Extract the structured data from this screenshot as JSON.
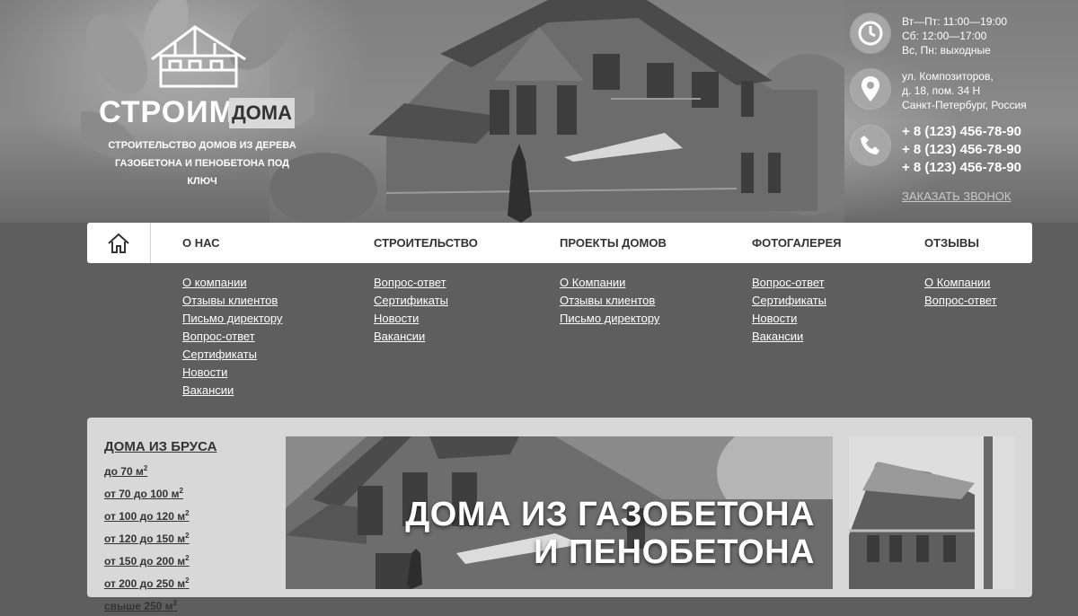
{
  "logo": {
    "word": "СТРОИМ",
    "box": "ДОМА",
    "subtitle_line1": "СТРОИТЕЛЬСТВО ДОМОВ ИЗ ДЕРЕВА",
    "subtitle_line2": "ГАЗОБЕТОНА И ПЕНОБЕТОНА ПОД КЛЮЧ"
  },
  "hours": {
    "line1": "Вт—Пт: 11:00—19:00",
    "line2": "Сб: 12:00—17:00",
    "line3": "Вс, Пн: выходные",
    "icon": "clock-icon"
  },
  "address": {
    "line1": "ул. Композиторов,",
    "line2": "д. 18, пом. 34 Н",
    "line3": "Санкт-Петербург, Россия",
    "icon": "location-pin-icon"
  },
  "phones": {
    "icon": "phone-icon",
    "items": [
      "+ 8 (123) 456-78-90",
      "+ 8 (123) 456-78-90",
      "+ 8 (123) 456-78-90"
    ]
  },
  "callback_label": "ЗАКАЗАТЬ ЗВОНОК",
  "nav": {
    "home_icon": "home-icon",
    "items": [
      {
        "label": "О НАС",
        "sub": [
          "О компании",
          "Отзывы клиентов",
          "Письмо директору",
          "Вопрос-ответ",
          "Сертификаты",
          "Новости",
          "Вакансии"
        ]
      },
      {
        "label": "СТРОИТЕЛЬСТВО",
        "sub": [
          "Вопрос-ответ",
          "Сертификаты",
          "Новости",
          "Вакансии"
        ]
      },
      {
        "label": "ПРОЕКТЫ ДОМОВ",
        "sub": [
          "О Компании",
          "Отзывы клиентов",
          "Письмо директору"
        ]
      },
      {
        "label": "ФОТОГАЛЕРЕЯ",
        "sub": [
          "Вопрос-ответ",
          "Сертификаты",
          "Новости",
          "Вакансии"
        ]
      },
      {
        "label": "ОТЗЫВЫ",
        "sub": [
          "О Компании",
          "Вопрос-ответ"
        ]
      }
    ]
  },
  "catalog": {
    "title": "ДОМА ИЗ БРУСА",
    "unit": "м",
    "unit_sup": "2",
    "items": [
      "до 70",
      "от 70 до 100",
      "от 100 до 120",
      "от 120 до 150",
      "от 150 до 200",
      "от 200 до 250",
      "свыше 250"
    ]
  },
  "banner": {
    "line1": "ДОМА ИЗ ГАЗОБЕТОНА",
    "line2": "И ПЕНОБЕТОНА"
  },
  "colors": {
    "page_bg": "#5e5e5e",
    "nav_bg": "#ffffff",
    "content_bg": "#d8d8d8",
    "icon_circle": "#a7a7a7"
  }
}
